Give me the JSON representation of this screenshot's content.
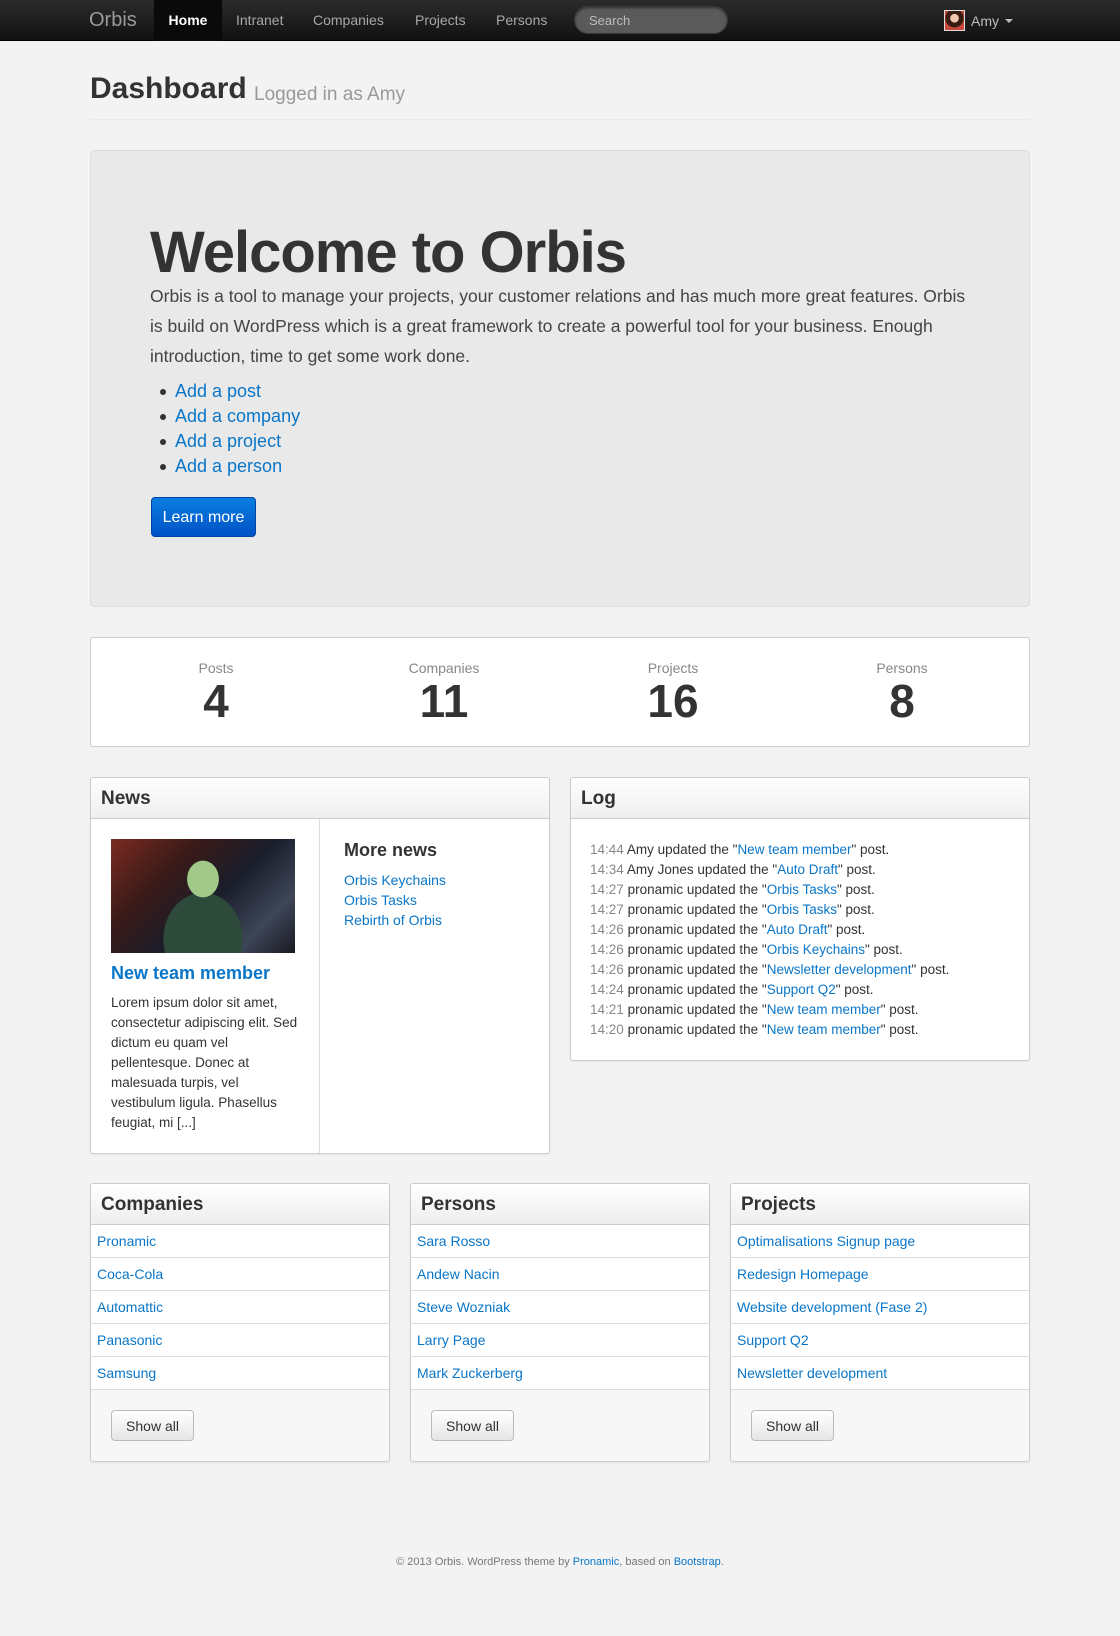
{
  "navbar": {
    "brand": "Orbis",
    "items": [
      {
        "label": "Home"
      },
      {
        "label": "Intranet"
      },
      {
        "label": "Companies"
      },
      {
        "label": "Projects"
      },
      {
        "label": "Persons"
      }
    ],
    "search_placeholder": "Search",
    "user_name": "Amy",
    "avatar_icon": "user-avatar"
  },
  "header": {
    "title": "Dashboard",
    "subtitle": "Logged in as Amy"
  },
  "hero": {
    "title": "Welcome to Orbis",
    "text": "Orbis is a tool to manage your projects, your customer relations and has much more great features. Orbis is build on WordPress which is a great framework to create a powerful tool for your business. Enough introduction, time to get some work done.",
    "links": [
      {
        "label": "Add a post"
      },
      {
        "label": "Add a company"
      },
      {
        "label": "Add a project"
      },
      {
        "label": "Add a person"
      }
    ],
    "button": "Learn more"
  },
  "stats": [
    {
      "label": "Posts",
      "value": "4"
    },
    {
      "label": "Companies",
      "value": "11"
    },
    {
      "label": "Projects",
      "value": "16"
    },
    {
      "label": "Persons",
      "value": "8"
    }
  ],
  "news": {
    "title": "News",
    "featured": {
      "title": "New team member",
      "excerpt": "Lorem ipsum dolor sit amet, consectetur adipiscing elit. Sed dictum eu quam vel pellentesque. Donec at malesuada turpis, vel vestibulum ligula. Phasellus feugiat, mi [...]"
    },
    "more_title": "More news",
    "more": [
      {
        "label": "Orbis Keychains"
      },
      {
        "label": "Orbis Tasks"
      },
      {
        "label": "Rebirth of Orbis"
      }
    ]
  },
  "log": {
    "title": "Log",
    "entries": [
      {
        "time": "14:44",
        "text": "Amy updated the \"",
        "link": "New team member",
        "after": "\" post."
      },
      {
        "time": "14:34",
        "text": "Amy Jones updated the \"",
        "link": "Auto Draft",
        "after": "\" post."
      },
      {
        "time": "14:27",
        "text": "pronamic updated the \"",
        "link": "Orbis Tasks",
        "after": "\" post."
      },
      {
        "time": "14:27",
        "text": "pronamic updated the \"",
        "link": "Orbis Tasks",
        "after": "\" post."
      },
      {
        "time": "14:26",
        "text": "pronamic updated the \"",
        "link": "Auto Draft",
        "after": "\" post."
      },
      {
        "time": "14:26",
        "text": "pronamic updated the \"",
        "link": "Orbis Keychains",
        "after": "\" post."
      },
      {
        "time": "14:26",
        "text": "pronamic updated the \"",
        "link": "Newsletter development",
        "after": "\" post."
      },
      {
        "time": "14:24",
        "text": "pronamic updated the \"",
        "link": "Support Q2",
        "after": "\" post."
      },
      {
        "time": "14:21",
        "text": "pronamic updated the \"",
        "link": "New team member",
        "after": "\" post."
      },
      {
        "time": "14:20",
        "text": "pronamic updated the \"",
        "link": "New team member",
        "after": "\" post."
      }
    ]
  },
  "companies": {
    "title": "Companies",
    "items": [
      "Pronamic",
      "Coca-Cola",
      "Automattic",
      "Panasonic",
      "Samsung"
    ],
    "button": "Show all"
  },
  "persons": {
    "title": "Persons",
    "items": [
      "Sara Rosso",
      "Andew Nacin",
      "Steve Wozniak",
      "Larry Page",
      "Mark Zuckerberg"
    ],
    "button": "Show all"
  },
  "projects": {
    "title": "Projects",
    "items": [
      "Optimalisations Signup page",
      "Redesign Homepage",
      "Website development (Fase 2)",
      "Support Q2",
      "Newsletter development"
    ],
    "button": "Show all"
  },
  "footer": {
    "prefix": "© 2013 Orbis. WordPress theme by ",
    "link1": "Pronamic",
    "middle": ", based on ",
    "link2": "Bootstrap",
    "suffix": "."
  },
  "colors": {
    "link": "#0a76c8",
    "primary_button": "#0066dd",
    "navbar": "#1a1a1a"
  }
}
